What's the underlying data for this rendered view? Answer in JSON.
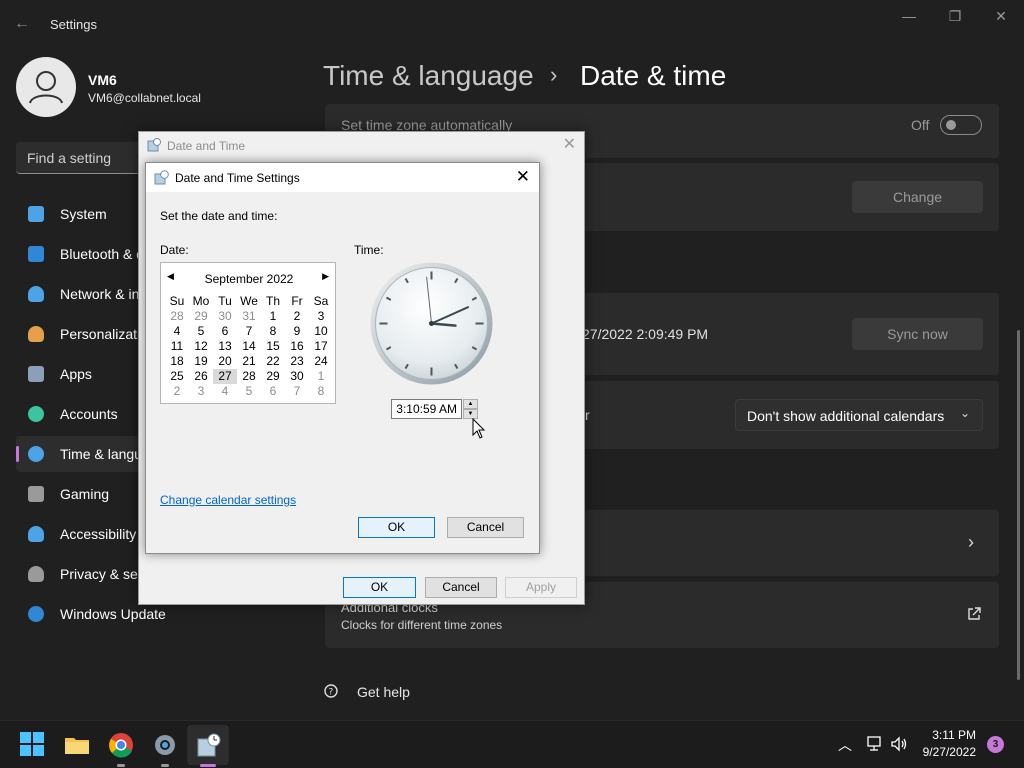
{
  "window": {
    "title": "Settings",
    "back_icon": "back-arrow-icon"
  },
  "user": {
    "name": "VM6",
    "email": "VM6@collabnet.local"
  },
  "search": {
    "placeholder": "Find a setting"
  },
  "sidebar": {
    "items": [
      {
        "label": "System",
        "icon": "monitor-icon",
        "color": "#4ca3e6"
      },
      {
        "label": "Bluetooth & devices",
        "icon": "bluetooth-icon",
        "color": "#2f87d6"
      },
      {
        "label": "Network & internet",
        "icon": "wifi-icon",
        "color": "#4ca3e6"
      },
      {
        "label": "Personalization",
        "icon": "brush-icon",
        "color": "#e6a04c"
      },
      {
        "label": "Apps",
        "icon": "apps-icon",
        "color": "#8aa0b8"
      },
      {
        "label": "Accounts",
        "icon": "person-icon",
        "color": "#3cc4a0"
      },
      {
        "label": "Time & language",
        "icon": "clock-globe-icon",
        "color": "#4ca3e6",
        "active": true
      },
      {
        "label": "Gaming",
        "icon": "gamepad-icon",
        "color": "#9a9a9a"
      },
      {
        "label": "Accessibility",
        "icon": "accessibility-icon",
        "color": "#4ca3e6"
      },
      {
        "label": "Privacy & security",
        "icon": "shield-icon",
        "color": "#9a9a9a"
      },
      {
        "label": "Windows Update",
        "icon": "update-icon",
        "color": "#2f87d6"
      }
    ]
  },
  "breadcrumb": {
    "parent": "Time & language",
    "separator": "›",
    "current": "Date & time"
  },
  "settings": {
    "tz_auto_label": "Set time zone automatically",
    "tz_auto_state": "Off",
    "change_button": "Change",
    "sync_time": "27/2022 2:09:49 PM",
    "sync_button": "Sync now",
    "cal_partial_label": "r",
    "calendars_dropdown": "Don't show additional calendars",
    "more_dots": "...",
    "additional_clocks_title": "Additional clocks",
    "additional_clocks_sub": "Clocks for different time zones",
    "get_help": "Get help"
  },
  "outer_dialog": {
    "title": "Date and Time",
    "ok": "OK",
    "cancel": "Cancel",
    "apply": "Apply"
  },
  "inner_dialog": {
    "title": "Date and Time Settings",
    "instruction": "Set the date and time:",
    "date_label": "Date:",
    "time_label": "Time:",
    "calendar": {
      "month": "September 2022",
      "day_headers": [
        "Su",
        "Mo",
        "Tu",
        "We",
        "Th",
        "Fr",
        "Sa"
      ],
      "weeks": [
        [
          "28",
          "29",
          "30",
          "31",
          "1",
          "2",
          "3"
        ],
        [
          "4",
          "5",
          "6",
          "7",
          "8",
          "9",
          "10"
        ],
        [
          "11",
          "12",
          "13",
          "14",
          "15",
          "16",
          "17"
        ],
        [
          "18",
          "19",
          "20",
          "21",
          "22",
          "23",
          "24"
        ],
        [
          "25",
          "26",
          "27",
          "28",
          "29",
          "30",
          "1"
        ],
        [
          "2",
          "3",
          "4",
          "5",
          "6",
          "7",
          "8"
        ]
      ],
      "selected_day": "27"
    },
    "time_value": "3:10:59 AM",
    "change_calendar_link": "Change calendar settings",
    "ok": "OK",
    "cancel": "Cancel"
  },
  "taskbar": {
    "time": "3:11 PM",
    "date": "9/27/2022",
    "notifications": "3"
  }
}
